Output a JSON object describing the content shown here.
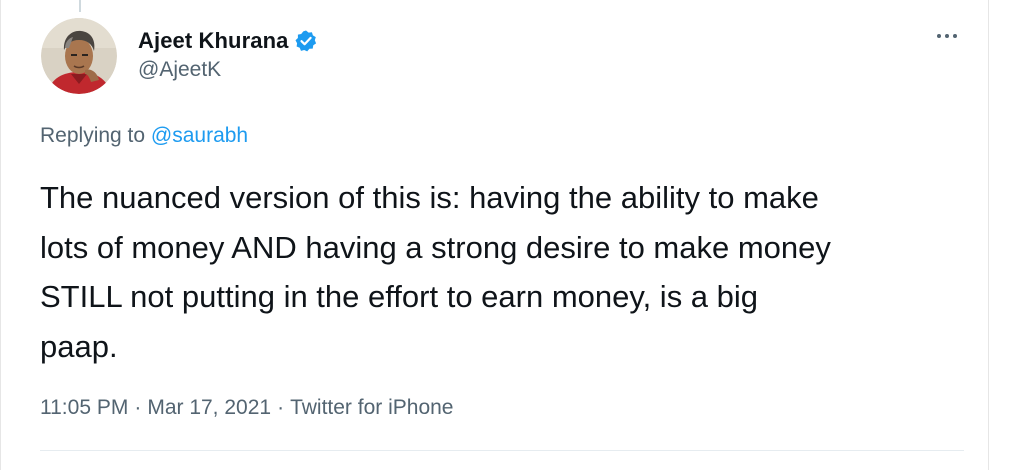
{
  "author": {
    "display_name": "Ajeet Khurana",
    "handle": "@AjeetK",
    "verified": true,
    "avatar_icon": "profile-photo"
  },
  "reply": {
    "prefix": "Replying to",
    "mention": "@saurabh"
  },
  "tweet": {
    "lines": [
      "The nuanced version of this is: having the ability to make",
      "lots of money AND having a strong desire to make money",
      "STILL not putting in the effort to earn money, is a big",
      "paap."
    ]
  },
  "meta": {
    "time": "11:05 PM",
    "separator": "·",
    "date": "Mar 17, 2021",
    "source": "Twitter for iPhone"
  },
  "colors": {
    "text": "#0f1419",
    "secondary": "#536471",
    "accent": "#1d9bf0"
  },
  "icons": {
    "verified": "verified-badge-icon",
    "more": "more-options-icon"
  }
}
